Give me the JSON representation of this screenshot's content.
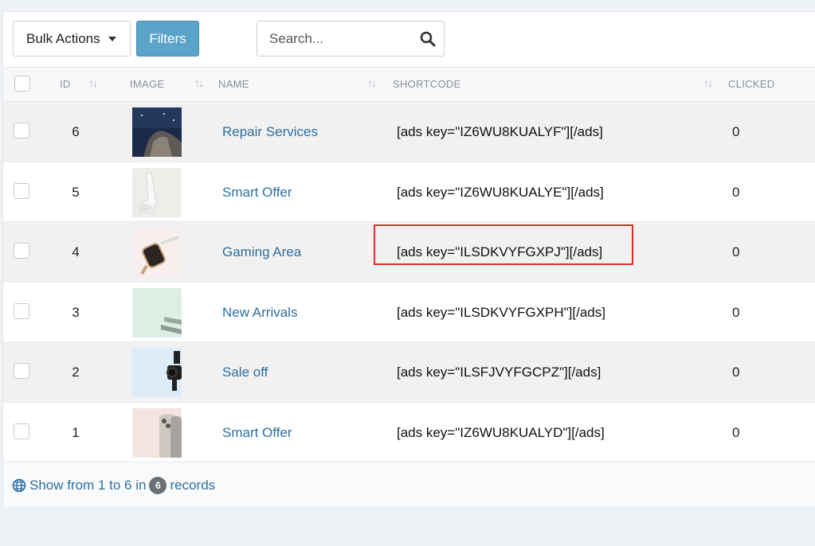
{
  "toolbar": {
    "bulk_actions_label": "Bulk Actions",
    "filters_label": "Filters",
    "search_placeholder": "Search..."
  },
  "table": {
    "columns": {
      "id": "ID",
      "image": "IMAGE",
      "name": "NAME",
      "shortcode": "SHORTCODE",
      "clicked": "CLICKED"
    },
    "rows": [
      {
        "id": "6",
        "name": "Repair Services",
        "shortcode": "[ads key=\"IZ6WU8KUALYF\"][/ads]",
        "clicked": "0"
      },
      {
        "id": "5",
        "name": "Smart Offer",
        "shortcode": "[ads key=\"IZ6WU8KUALYE\"][/ads]",
        "clicked": "0"
      },
      {
        "id": "4",
        "name": "Gaming Area",
        "shortcode": "[ads key=\"ILSDKVYFGXPJ\"][/ads]",
        "clicked": "0"
      },
      {
        "id": "3",
        "name": "New Arrivals",
        "shortcode": "[ads key=\"ILSDKVYFGXPH\"][/ads]",
        "clicked": "0"
      },
      {
        "id": "2",
        "name": "Sale off",
        "shortcode": "[ads key=\"ILSFJVYFGCPZ\"][/ads]",
        "clicked": "0"
      },
      {
        "id": "1",
        "name": "Smart Offer",
        "shortcode": "[ads key=\"IZ6WU8KUALYD\"][/ads]",
        "clicked": "0"
      }
    ]
  },
  "footer": {
    "prefix": "Show from 1 to 6 in",
    "count": "6",
    "suffix": "records"
  },
  "colors": {
    "accent": "#5aa3c9",
    "link": "#2f6fa0",
    "highlight": "#d9322a"
  }
}
